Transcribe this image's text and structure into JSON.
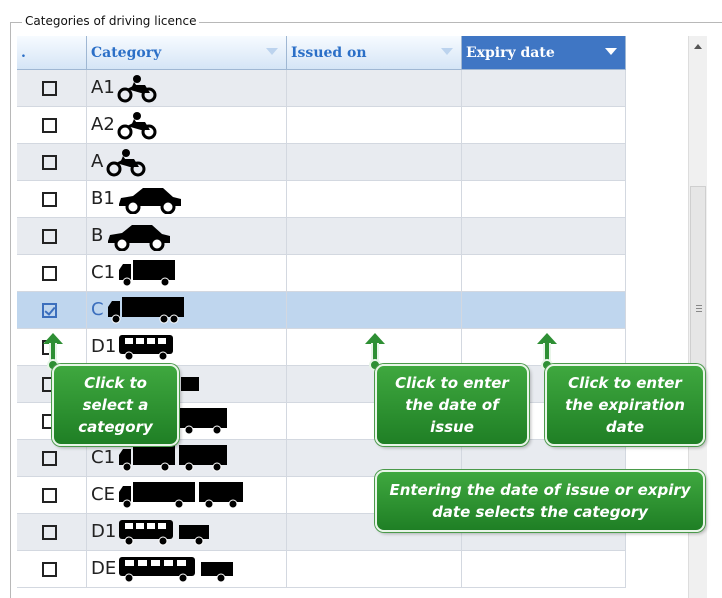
{
  "group_title": "Categories of driving licence",
  "columns": {
    "select": ".",
    "category": "Category",
    "issued_on": "Issued on",
    "expiry_date": "Expiry date"
  },
  "rows": [
    {
      "category": "A1",
      "checked": false,
      "vehicle": "motorcycle"
    },
    {
      "category": "A2",
      "checked": false,
      "vehicle": "motorcycle"
    },
    {
      "category": "A",
      "checked": false,
      "vehicle": "motorcycle"
    },
    {
      "category": "B1",
      "checked": false,
      "vehicle": "car"
    },
    {
      "category": "B",
      "checked": false,
      "vehicle": "car"
    },
    {
      "category": "C1",
      "checked": false,
      "vehicle": "truck"
    },
    {
      "category": "C",
      "checked": true,
      "vehicle": "large-truck"
    },
    {
      "category": "D1",
      "checked": false,
      "vehicle": "bus"
    },
    {
      "category": "",
      "checked": false,
      "vehicle": "car-trailer"
    },
    {
      "category": "",
      "checked": false,
      "vehicle": "truck-trailer"
    },
    {
      "category": "C1",
      "checked": false,
      "vehicle": "truck-trailer"
    },
    {
      "category": "CE",
      "checked": false,
      "vehicle": "large-truck-trailer"
    },
    {
      "category": "D1",
      "checked": false,
      "vehicle": "bus-trailer"
    },
    {
      "category": "DE",
      "checked": false,
      "vehicle": "large-bus-trailer"
    }
  ],
  "callouts": {
    "select_category": "Click to select a category",
    "date_of_issue": "Click to enter the date of issue",
    "expiration_date": "Click to enter the expiration date",
    "selects_category": "Entering the date of issue or expiry date selects the category"
  },
  "colors": {
    "header_active": "#3f76c4",
    "selected_row": "#bfd6ee",
    "callout_green": "#2e8f34"
  }
}
